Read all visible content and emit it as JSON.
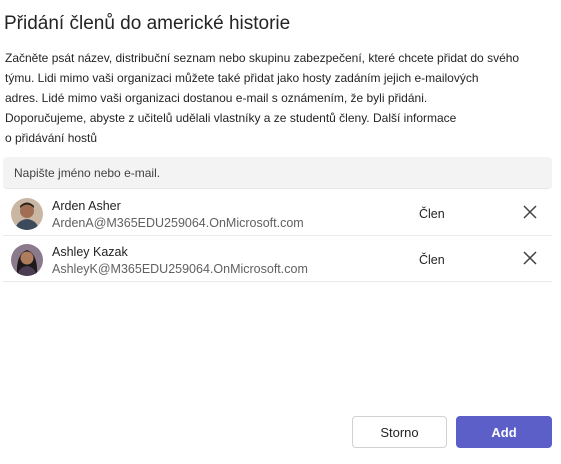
{
  "dialog": {
    "title": "Přidání členů do americké historie",
    "description_lines": [
      "Začněte psát název, distribuční seznam nebo skupinu zabezpečení, které chcete přidat do svého",
      "týmu. Lidi mimo vaši organizaci můžete také přidat jako hosty zadáním jejich e-mailových",
      "adres. Lidé mimo vaši organizaci dostanou e-mail s oznámením, že byli přidáni.",
      "Doporučujeme, abyste z učitelů udělali vlastníky a ze studentů členy. Další informace",
      "o přidávání hostů"
    ]
  },
  "search": {
    "placeholder": "Napište jméno nebo e-mail."
  },
  "members": [
    {
      "name": "Arden Asher",
      "email": "ArdenA@M365EDU259064.OnMicrosoft.com",
      "role": "Člen",
      "avatar_bg": "#6b4a3a"
    },
    {
      "name": "Ashley Kazak",
      "email": "AshleyK@M365EDU259064.OnMicrosoft.com",
      "role": "Člen",
      "avatar_bg": "#2f2a2c"
    }
  ],
  "buttons": {
    "cancel_label": "Storno",
    "add_label": "Add"
  },
  "colors": {
    "primary": "#5b5fc7",
    "search_bg": "#f3f3f3",
    "secondary_text": "#616161"
  }
}
